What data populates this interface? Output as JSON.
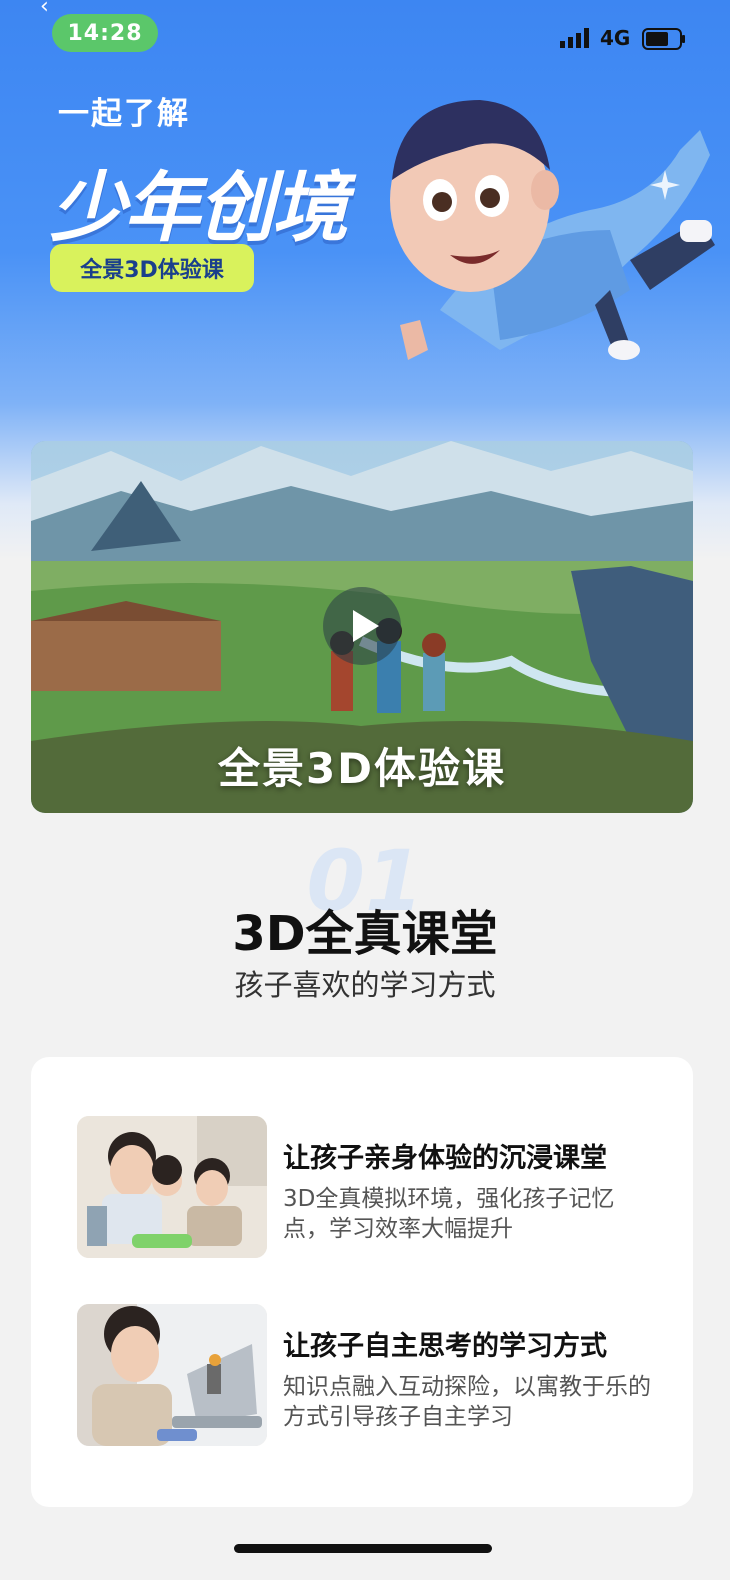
{
  "status_bar": {
    "time": "14:28",
    "network": "4G"
  },
  "hero": {
    "subtitle": "一起了解",
    "title": "少年创境",
    "tag": "全景3D体验课"
  },
  "video": {
    "caption": "全景3D体验课"
  },
  "section": {
    "number": "01",
    "title": "3D全真课堂",
    "subtitle": "孩子喜欢的学习方式"
  },
  "features": [
    {
      "title": "让孩子亲身体验的沉浸课堂",
      "description": "3D全真模拟环境，强化孩子记忆点，学习效率大幅提升"
    },
    {
      "title": "让孩子自主思考的学习方式",
      "description": "知识点融入互动探险，以寓教于乐的方式引导孩子自主学习"
    }
  ]
}
